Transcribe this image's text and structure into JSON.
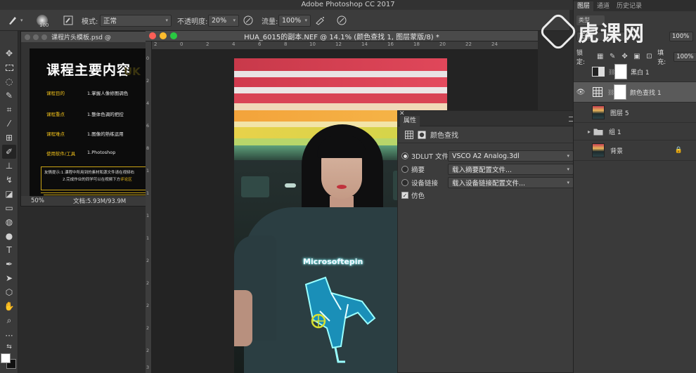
{
  "app": {
    "title": "Adobe Photoshop CC 2017"
  },
  "options_bar": {
    "brush_size": "100",
    "mode_label": "模式:",
    "mode_value": "正常",
    "opacity_label": "不透明度:",
    "opacity_value": "20%",
    "flow_label": "流量:",
    "flow_value": "100%"
  },
  "template_window": {
    "tab_title": "课程片头模板.psd @",
    "heading": "课程主要内容",
    "ghost_text": "UK",
    "rows": [
      {
        "label": "课程目的",
        "value": "1.掌握人像修图调色"
      },
      {
        "label": "课程重点",
        "value": "1.整体色调的把控"
      },
      {
        "label": "课程难点",
        "value": "1.图像的熟练运用"
      },
      {
        "label": "使用软件/工具",
        "value": "1.Photoshop"
      }
    ],
    "note_line1": "友情提示:1.课程中所用到的素材和源文件请在视频右",
    "note_line2_pre": "2.完成作业的同学可以在视频下方",
    "note_line2_hl": "评论区",
    "zoom": "50%",
    "doc_size": "文档:5.93M/93.9M"
  },
  "document": {
    "tab_title": "HUA_6015的副本.NEF @ 14.1% (颜色查找 1, 图层蒙版/8) *",
    "ruler_h": [
      "2",
      "0",
      "2",
      "4",
      "6",
      "8",
      "10",
      "12",
      "14",
      "16",
      "18",
      "20",
      "22",
      "24"
    ],
    "ruler_v": [
      "0",
      "2",
      "4",
      "6",
      "8",
      "1",
      "1",
      "1",
      "1",
      "2",
      "2",
      "2",
      "2",
      "2",
      "3"
    ],
    "shirt_text": "Microsoftepin"
  },
  "properties": {
    "tab_label": "属性",
    "section_title": "颜色查找",
    "lut_label": "3DLUT 文件",
    "lut_value": "VSCO A2 Analog.3dl",
    "abstract_label": "摘要",
    "abstract_value": "载入摘要配置文件...",
    "devicelink_label": "设备链接",
    "devicelink_value": "载入设备链接配置文件...",
    "dither_label": "仿色"
  },
  "layers_panel": {
    "tabs": [
      "图层",
      "通道",
      "历史记录"
    ],
    "filter_label": "类型",
    "blend_mode": "正常",
    "opacity_value": "100%",
    "lock_label": "锁定:",
    "fill_label": "填充:",
    "fill_value": "100%",
    "layers": [
      {
        "name": "黑白 1",
        "visible": false,
        "type": "adjustment"
      },
      {
        "name": "颜色查找 1",
        "visible": true,
        "type": "adjustment",
        "selected": true
      },
      {
        "name": "图层 5",
        "visible": false,
        "type": "pixel"
      },
      {
        "name": "组 1",
        "visible": false,
        "type": "group"
      },
      {
        "name": "背景",
        "visible": false,
        "type": "background"
      }
    ]
  },
  "watermark": {
    "text": "虎课网"
  }
}
